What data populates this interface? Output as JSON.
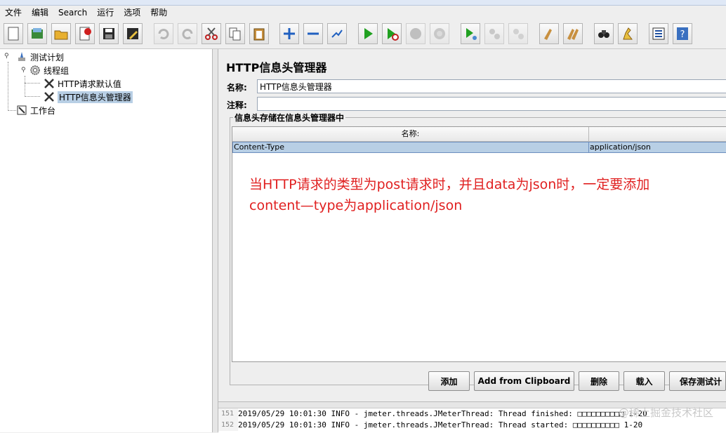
{
  "menu": [
    "文件",
    "编辑",
    "Search",
    "运行",
    "选项",
    "帮助"
  ],
  "tree": {
    "test_plan": "测试计划",
    "thread_group": "线程组",
    "http_defaults": "HTTP请求默认值",
    "http_header_manager": "HTTP信息头管理器",
    "workbench": "工作台"
  },
  "panel": {
    "title": "HTTP信息头管理器",
    "name_label": "名称:",
    "name_value": "HTTP信息头管理器",
    "comment_label": "注释:",
    "group_title": "信息头存储在信息头管理器中",
    "columns": [
      "名称:",
      ""
    ],
    "rows": [
      {
        "name": "Content-Type",
        "value": "application/json"
      }
    ],
    "annotation_line1": "当HTTP请求的类型为post请求时，并且data为json时，一定要添加",
    "annotation_line2": "content—type为application/json"
  },
  "buttons": {
    "add": "添加",
    "add_clipboard": "Add from Clipboard",
    "delete": "删除",
    "load": "载入",
    "save": "保存测试计"
  },
  "log": [
    {
      "line": "151",
      "text": "2019/05/29 10:01:30 INFO  - jmeter.threads.JMeterThread: Thread finished: □□□□□□□□□□ 1-20"
    },
    {
      "line": "152",
      "text": "2019/05/29 10:01:30 INFO  - jmeter.threads.JMeterThread: Thread started: □□□□□□□□□□ 1-20"
    }
  ],
  "watermark": "@稀土掘金技术社区"
}
